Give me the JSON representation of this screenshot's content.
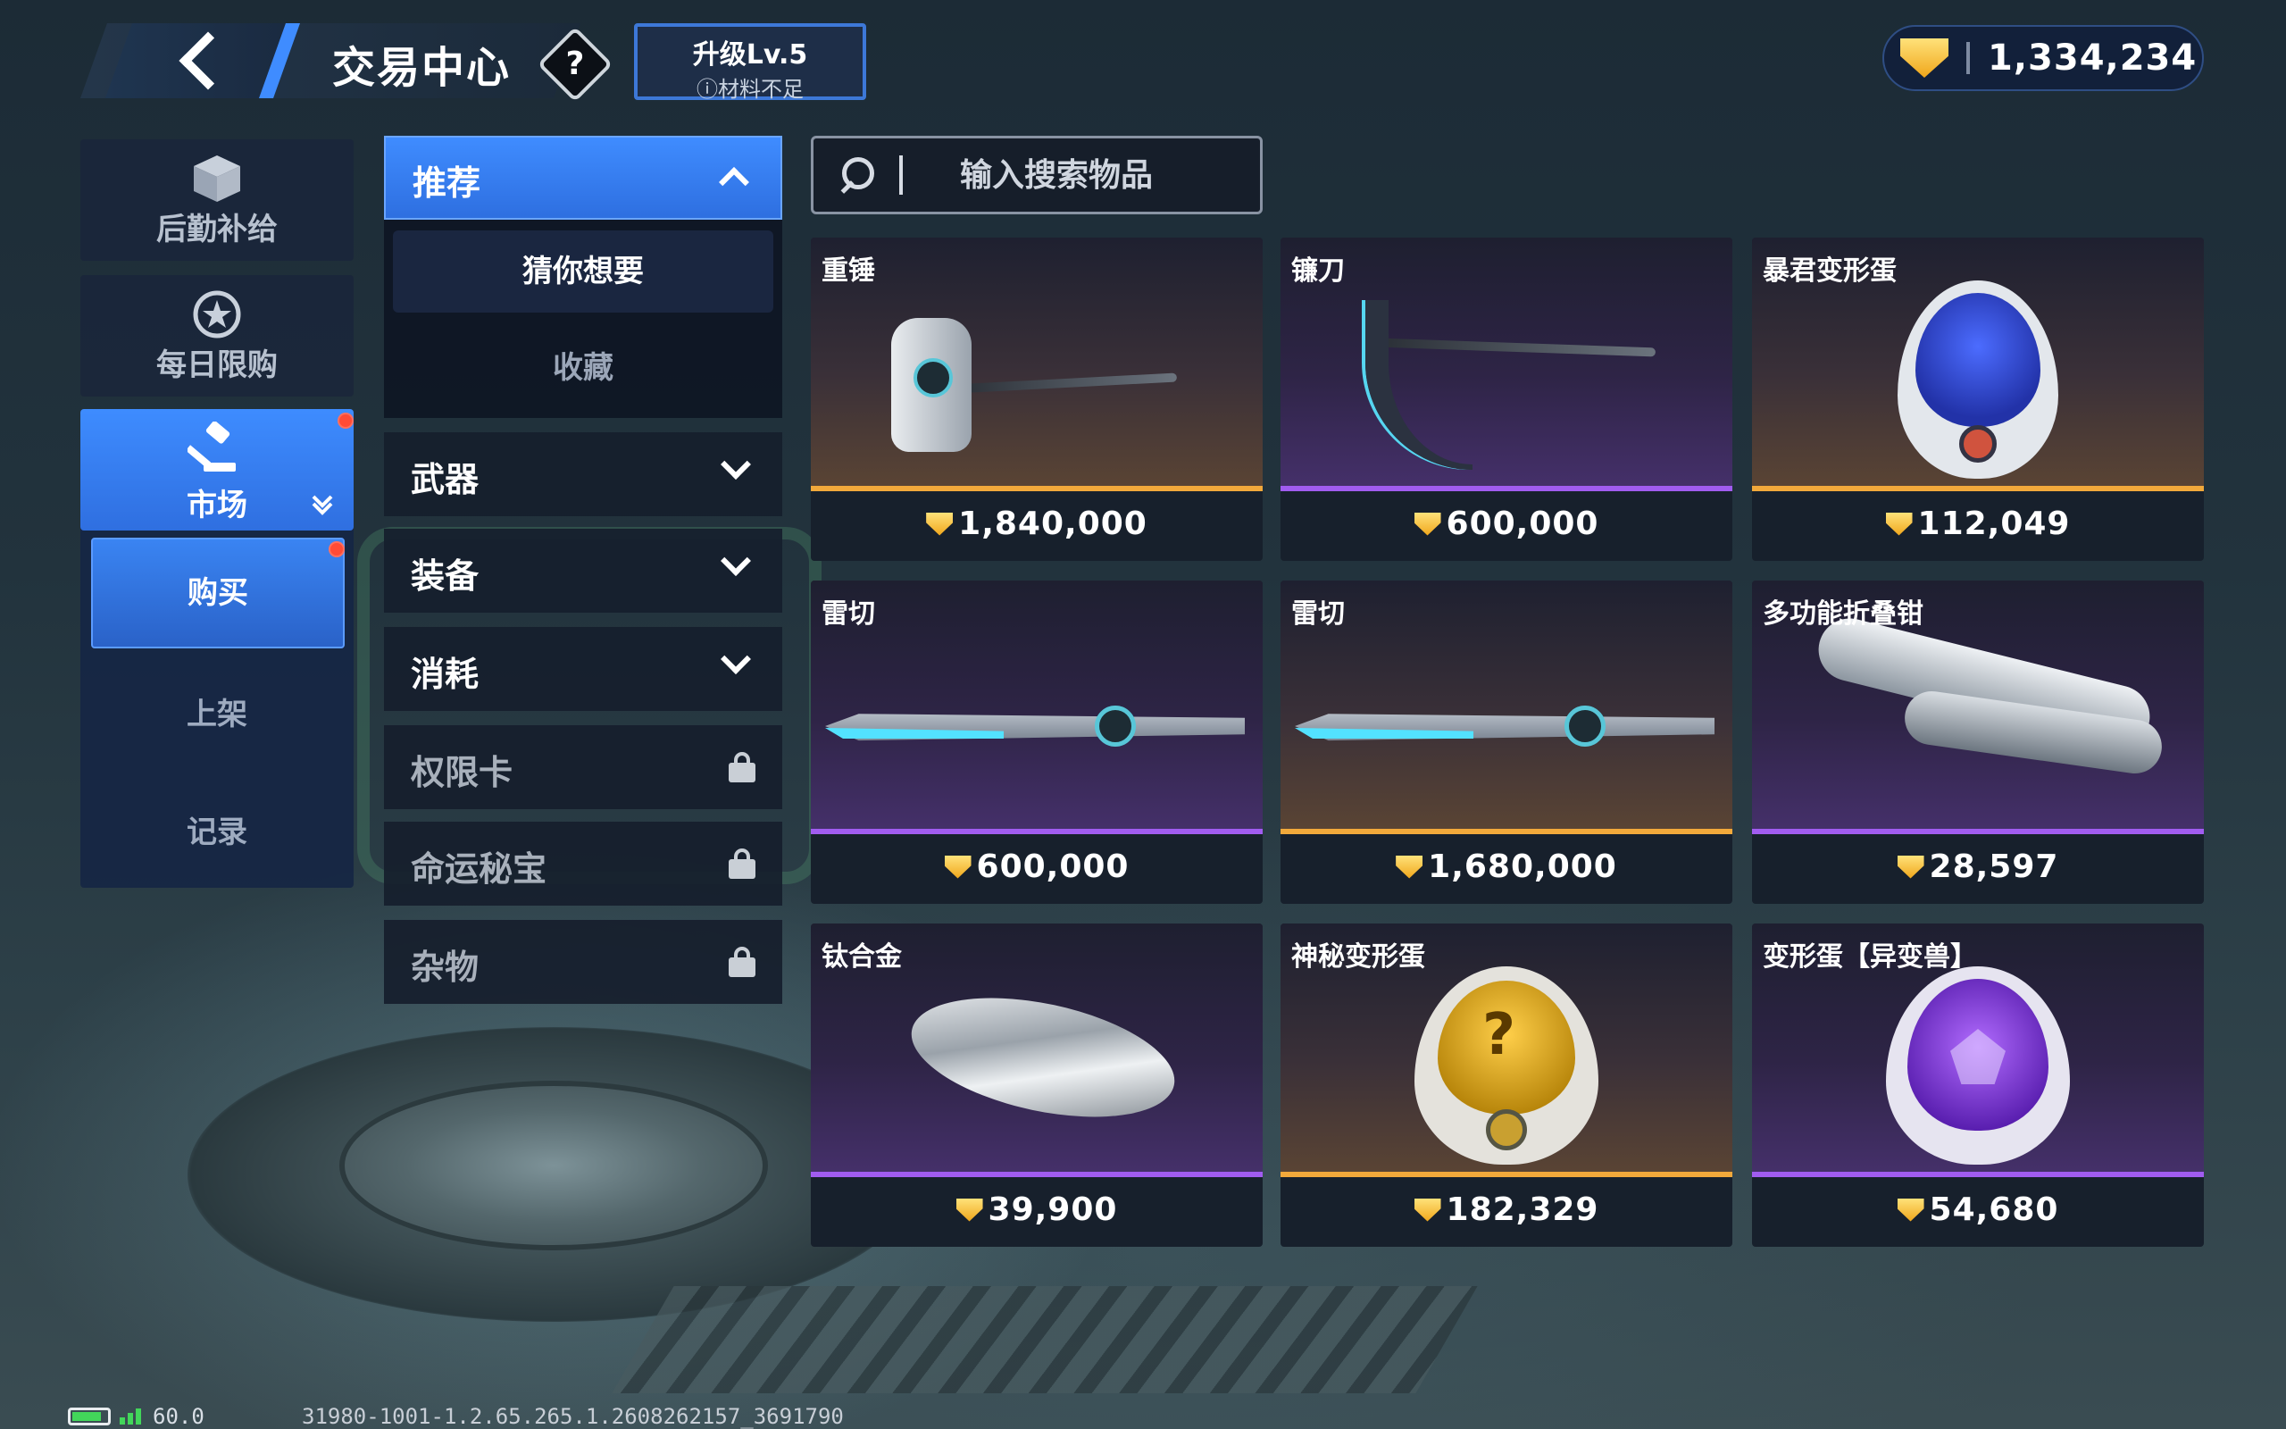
{
  "header": {
    "title": "交易中心",
    "help_icon": "?",
    "upgrade_title": "升级Lv.5",
    "upgrade_sub": "ⓘ材料不足",
    "currency_amount": "1,334,234"
  },
  "sidebar": {
    "items": [
      {
        "label": "后勤补给",
        "icon": "supply-box-icon"
      },
      {
        "label": "每日限购",
        "icon": "daily-star-icon"
      },
      {
        "label": "市场",
        "icon": "auction-hammer-icon"
      }
    ],
    "market_sub": [
      {
        "label": "购买"
      },
      {
        "label": "上架"
      },
      {
        "label": "记录"
      }
    ]
  },
  "categories": {
    "recommend": "推荐",
    "recommend_sub": [
      "猜你想要",
      "收藏"
    ],
    "list": [
      {
        "label": "武器",
        "locked": false
      },
      {
        "label": "装备",
        "locked": false
      },
      {
        "label": "消耗",
        "locked": false
      },
      {
        "label": "权限卡",
        "locked": true
      },
      {
        "label": "命运秘宝",
        "locked": true
      },
      {
        "label": "杂物",
        "locked": true
      }
    ]
  },
  "search": {
    "placeholder": "输入搜索物品"
  },
  "items": [
    {
      "name": "重锤",
      "price": "1,840,000",
      "rarity": "gold"
    },
    {
      "name": "镰刀",
      "price": "600,000",
      "rarity": "purple"
    },
    {
      "name": "暴君变形蛋",
      "price": "112,049",
      "rarity": "gold"
    },
    {
      "name": "雷切",
      "price": "600,000",
      "rarity": "purple"
    },
    {
      "name": "雷切",
      "price": "1,680,000",
      "rarity": "gold"
    },
    {
      "name": "多功能折叠钳",
      "price": "28,597",
      "rarity": "purple"
    },
    {
      "name": "钛合金",
      "price": "39,900",
      "rarity": "purple"
    },
    {
      "name": "神秘变形蛋",
      "price": "182,329",
      "rarity": "gold"
    },
    {
      "name": "变形蛋【异变兽】",
      "price": "54,680",
      "rarity": "purple"
    }
  ],
  "status_bar": {
    "fps": "60.0",
    "build": "31980-1001-1.2.65.265.1.2608262157_3691790"
  },
  "colors": {
    "accent_blue": "#3f8cff",
    "gold_rarity": "#f2a93b",
    "purple_rarity": "#a15cf0",
    "notify_red": "#ff4b36"
  }
}
